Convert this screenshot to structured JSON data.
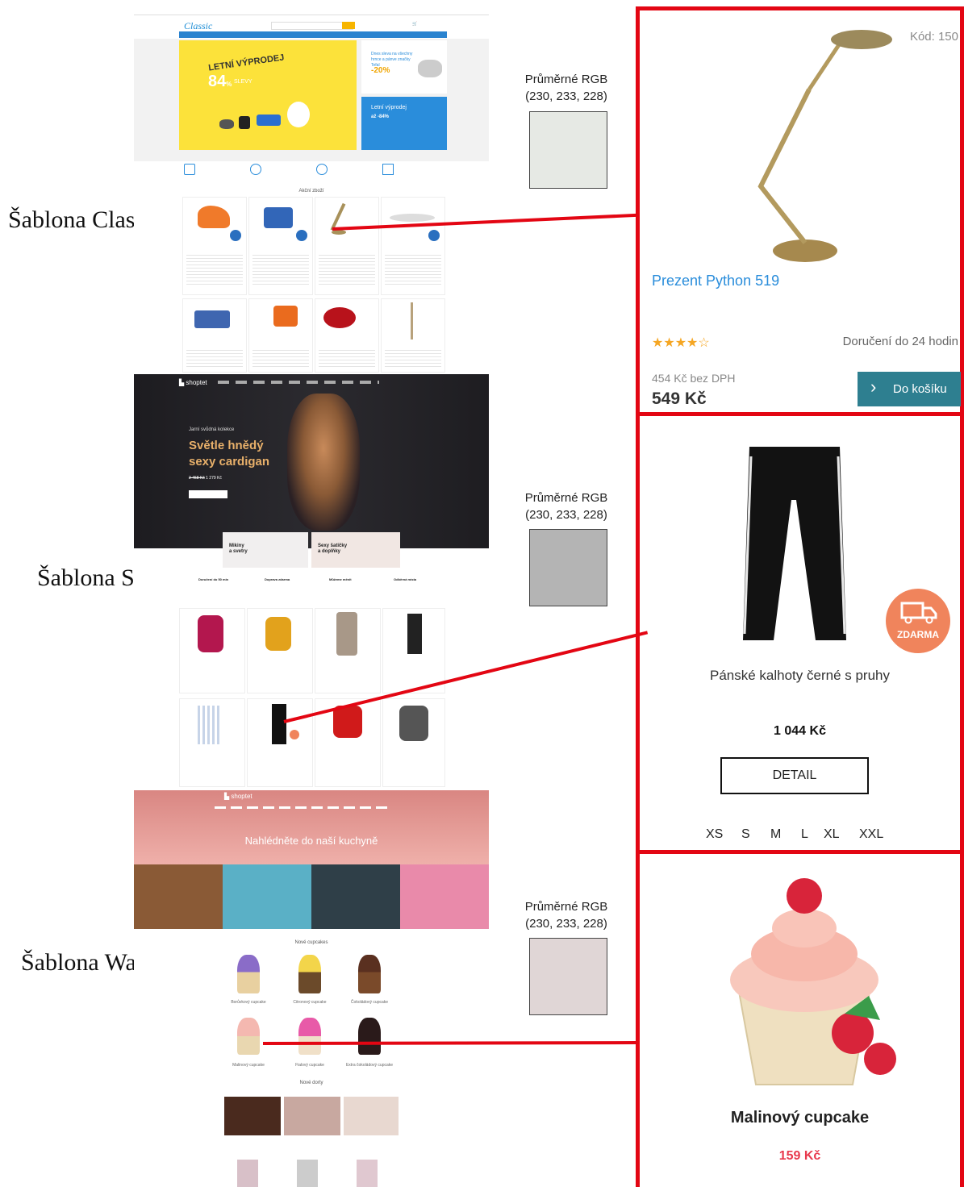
{
  "templates": [
    {
      "name": "Šablona Classic",
      "rgb_label": "Průměrné RGB",
      "rgb_value": "(230, 233, 228)",
      "swatch_color": "#e6e9e4"
    },
    {
      "name": "Šablona Step",
      "rgb_label": "Průměrné RGB",
      "rgb_value": "(230, 233, 228)",
      "swatch_color": "#b4b4b4"
    },
    {
      "name": "Šablona Waltz",
      "rgb_label": "Průměrné RGB",
      "rgb_value": "(230, 233, 228)",
      "swatch_color": "#e0d6d6"
    }
  ],
  "classic": {
    "logo": "Classic",
    "hero_title": "LETNÍ VÝPRODEJ",
    "hero_discount": "84",
    "hero_discount_unit": "%",
    "hero_discount_label": "SLEVY",
    "promo1_title": "Dnes sleva na všechny hrnce a pánve značky Tefal",
    "promo1_discount": "-20%",
    "promo2_title": "Letní výprodej",
    "promo2_discount": "až -84%",
    "section_title": "Akční zboží"
  },
  "step": {
    "logo": "shoptet",
    "hero_kicker": "Jarní svůdná kolekce",
    "hero_title_1": "Světle hnědý",
    "hero_title_2": "sexy cardigan",
    "hero_price_old": "2 458 Kč",
    "hero_price_new": "1 279 Kč",
    "banner1_title_1": "Mikiny",
    "banner1_title_2": "a svetry",
    "banner2_title_1": "Sexy šatičky",
    "banner2_title_2": "a doplňky",
    "usp1": "Doručení do 50 min",
    "usp2": "Doprava zdarma",
    "usp3": "Můžeme měnit",
    "usp4": "Odběrná místa"
  },
  "waltz": {
    "logo": "shoptet",
    "hero_title": "Nahlédněte do naší kuchyně",
    "section1": "Nové cupcakes",
    "section2": "Nové dorty",
    "products": [
      "Borůvkový cupcake",
      "Citronový cupcake",
      "Čokoládový cupcake",
      "Malinový cupcake",
      "Fialový cupcake",
      "Extra čokoládový cupcake"
    ]
  },
  "zoom_classic": {
    "code": "Kód: 150",
    "product_name": "Prezent Python 519",
    "rating": 4,
    "rating_stars": "★★★★☆",
    "delivery": "Doručení do 24 hodin",
    "price_no_vat": "454 Kč bez DPH",
    "price": "549 Kč",
    "cart_button": "Do košíku",
    "button_color": "#2e7f90"
  },
  "zoom_step": {
    "badge": "ZDARMA",
    "badge_color": "#f0845c",
    "product_name": "Pánské kalhoty černé s pruhy",
    "price": "1 044 Kč",
    "detail_button": "DETAIL",
    "sizes": [
      "XS",
      "S",
      "M",
      "L",
      "XL",
      "XXL"
    ]
  },
  "zoom_waltz": {
    "product_name": "Malinový cupcake",
    "price": "159 Kč",
    "price_color": "#e8394d"
  }
}
